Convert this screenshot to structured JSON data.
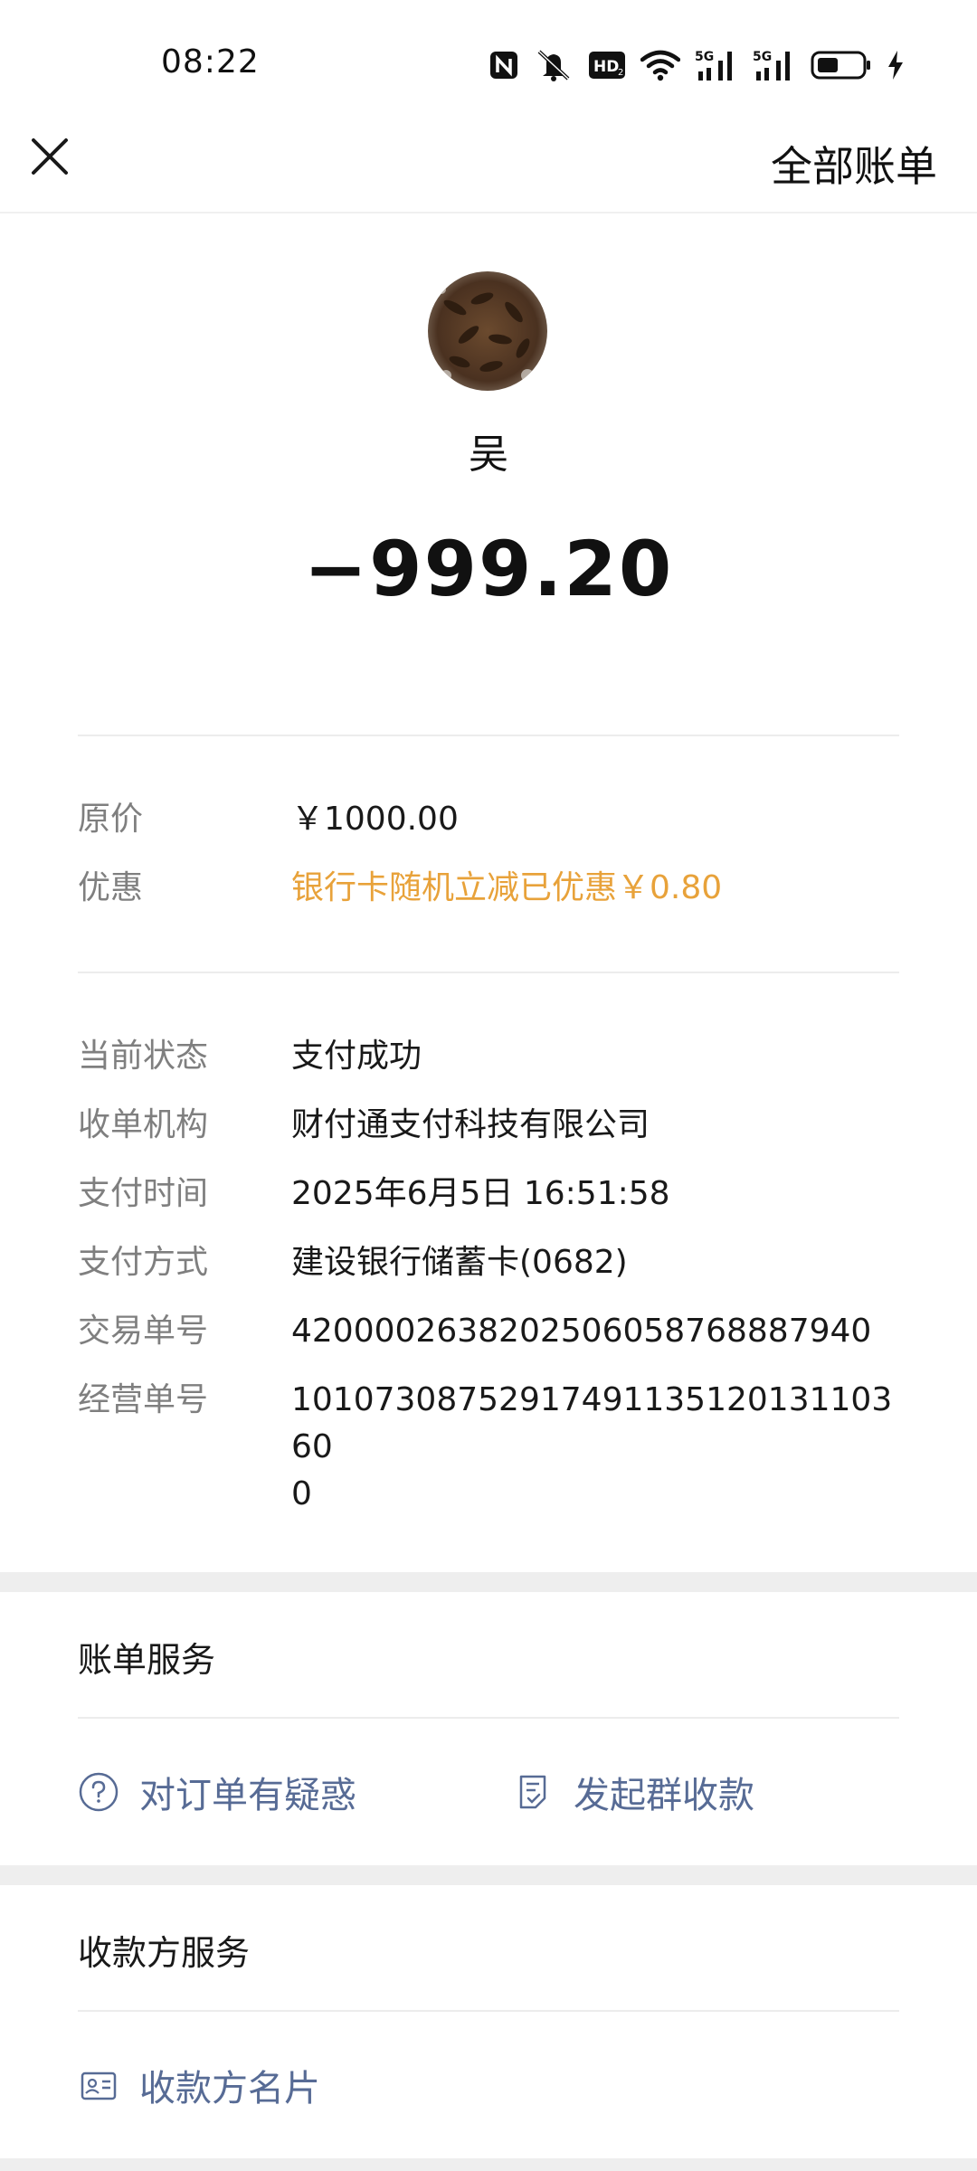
{
  "status_bar": {
    "time": "08:22",
    "icons": [
      "nfc-icon",
      "mute-icon",
      "hd-icon",
      "wifi-icon",
      "5g-signal-icon",
      "5g-signal-icon",
      "battery-icon",
      "charging-icon"
    ]
  },
  "header": {
    "close_icon": "close-icon",
    "all_bills": "全部账单"
  },
  "merchant": {
    "name": "吴",
    "amount": "−999.20"
  },
  "pricing": {
    "original_label": "原价",
    "original_value": "￥1000.00",
    "discount_label": "优惠",
    "discount_value": "银行卡随机立减已优惠￥0.80",
    "discount_color": "#e8a23a"
  },
  "details": [
    {
      "label": "当前状态",
      "value": "支付成功"
    },
    {
      "label": "收单机构",
      "value": "财付通支付科技有限公司"
    },
    {
      "label": "支付时间",
      "value": "2025年6月5日 16:51:58"
    },
    {
      "label": "支付方式",
      "value": "建设银行储蓄卡(0682)"
    },
    {
      "label": "交易单号",
      "value": "4200002638202506058768887940"
    },
    {
      "label": "经营单号",
      "value": "1010730875291749113512013110360\n0"
    }
  ],
  "bill_service": {
    "title": "账单服务",
    "items": [
      {
        "label": "对订单有疑惑",
        "icon": "question-circle-icon"
      },
      {
        "label": "发起群收款",
        "icon": "group-collect-icon"
      }
    ]
  },
  "payee_service": {
    "title": "收款方服务",
    "items": [
      {
        "label": "收款方名片",
        "icon": "business-card-icon"
      }
    ]
  },
  "colors": {
    "link": "#576b95",
    "label": "#7f7f7f",
    "section_gap": "#eeeeee"
  }
}
